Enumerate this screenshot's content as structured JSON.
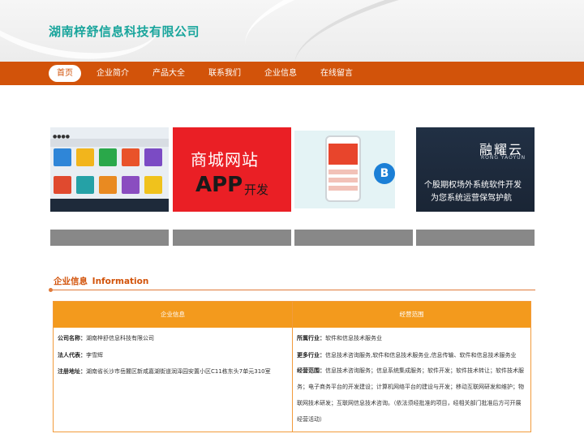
{
  "site": {
    "title": "湖南梓舒信息科技有限公司"
  },
  "nav": {
    "items": [
      "首页",
      "企业简介",
      "产品大全",
      "联系我们",
      "企业信息",
      "在线留言"
    ],
    "active_index": 0
  },
  "gallery": {
    "cards": [
      {
        "image": "app-grid-screenshot"
      },
      {
        "image": "mall-app-banner",
        "text_line1": "商城网站",
        "text_line2": "APP",
        "text_line2b": "开发"
      },
      {
        "image": "mobile-phone-mockup",
        "logo_letter": "B"
      },
      {
        "image": "software-dev-banner",
        "brand": "融耀云",
        "brand_sub": "RONG YAOYUN",
        "line1": "个股期权场外系统软件开发",
        "line2": "为您系统运营保驾护航"
      }
    ]
  },
  "section": {
    "title_cn": "企业信息",
    "title_en": "Information"
  },
  "table": {
    "left_header": "企业信息",
    "right_header": "经营范围",
    "left_rows": [
      {
        "label": "公司名称：",
        "value": "湖南梓舒信息科技有限公司"
      },
      {
        "label": "法人代表：",
        "value": "李雪辉"
      },
      {
        "label": "注册地址：",
        "value": "湖南省长沙市岳麓区新咸嘉湖街道润泽园安置小区C11栋东头7单元310室"
      }
    ],
    "right_rows": [
      {
        "label": "所属行业：",
        "value": "软件和信息技术服务业"
      },
      {
        "label": "更多行业：",
        "value": "信息技术咨询服务,软件和信息技术服务业,信息传输、软件和信息技术服务业"
      },
      {
        "label": "经营范围：",
        "value": "信息技术咨询服务；信息系统集成服务；软件开发；软件技术转让；软件技术服务；电子商务平台的开发建设；计算机网络平台的建设与开发；移动互联网研发和维护；物联网技术研发；互联网信息技术咨询。（依法须经批准的项目，经相关部门批准后方可开展经营活动）"
      }
    ]
  },
  "colors": {
    "accent": "#d2530a",
    "title": "#19a59c",
    "table_header": "#f39a1d",
    "table_border": "#f29b3c"
  }
}
